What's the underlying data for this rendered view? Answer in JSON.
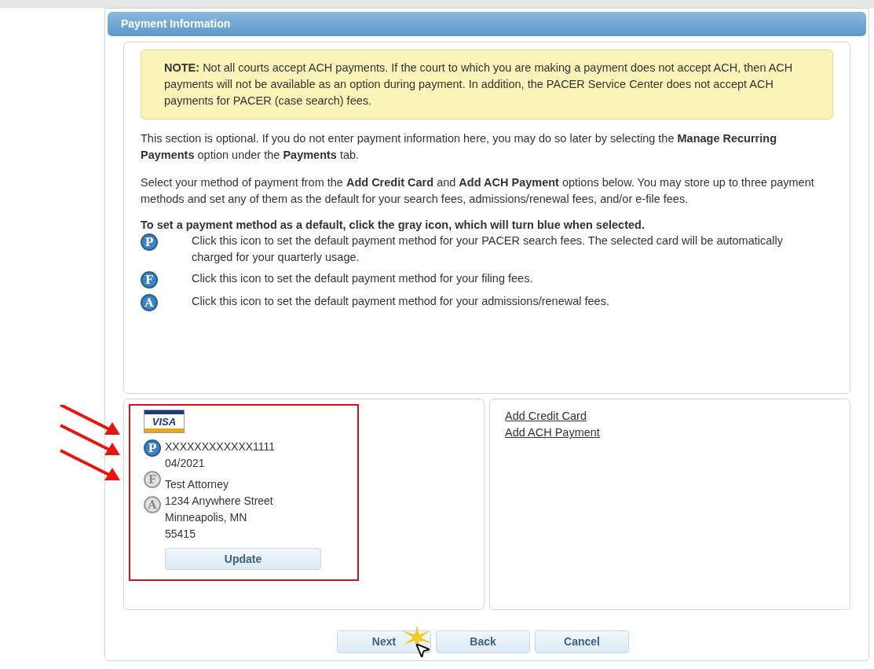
{
  "panel": {
    "title": "Payment Information"
  },
  "note": "**NOTE:** Not all courts accept ACH payments. If the court to which you are making a payment does not accept ACH, then ACH payments will not be available as an option during payment. In addition, the PACER Service Center does not accept ACH payments for PACER (case search) fees.",
  "paragraphs": [
    "This section is optional. If you do not enter payment information here, you may do so later by selecting the **Manage Recurring Payments** option under the **Payments** tab.",
    "Select your method of payment from the **Add Credit Card** and **Add ACH Payment** options below. You may store up to three payment methods and set any of them as the default for your search fees, admissions/renewal fees, and/or e-file fees."
  ],
  "legend": {
    "heading": "To set a payment method as a default, click the gray icon, which will turn blue when selected.",
    "items": [
      {
        "letter": "P",
        "text": "Click this icon to set the default payment method for your PACER search fees. The selected card will be automatically charged for your quarterly usage."
      },
      {
        "letter": "F",
        "text": "Click this icon to set the default payment method for your filing fees."
      },
      {
        "letter": "A",
        "text": "Click this icon to set the default payment method for your admissions/renewal fees."
      }
    ]
  },
  "card": {
    "brand": "VISA",
    "highlighted": true,
    "defaults": [
      {
        "letter": "P",
        "selected": true
      },
      {
        "letter": "F",
        "selected": false
      },
      {
        "letter": "A",
        "selected": false
      }
    ],
    "lines": [
      "XXXXXXXXXXXX1111",
      "04/2021",
      "Test Attorney",
      "1234 Anywhere Street",
      "Minneapolis, MN",
      "55415"
    ],
    "button": "Update"
  },
  "links": [
    "Add Credit Card",
    "Add ACH Payment"
  ],
  "buttons": [
    "Next",
    "Back",
    "Cancel"
  ]
}
